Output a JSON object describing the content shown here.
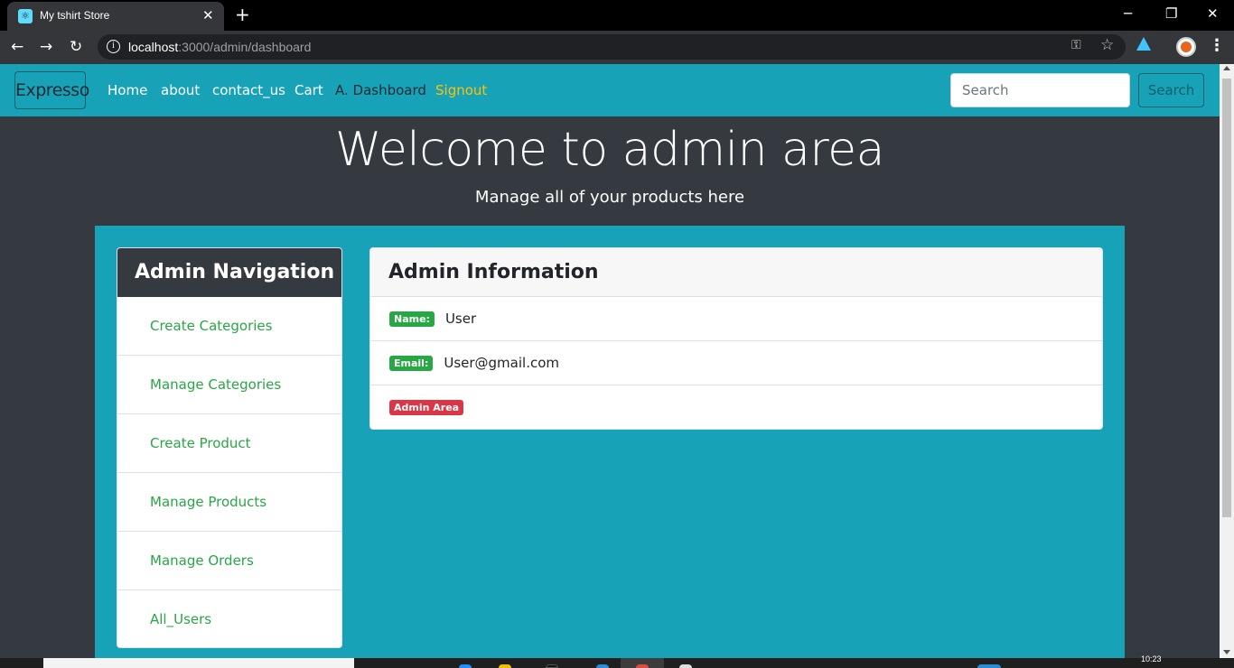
{
  "browser": {
    "tab_title": "My tshirt Store",
    "tab_close": "✕",
    "new_tab": "+",
    "url_host": "localhost",
    "url_path": ":3000/admin/dashboard",
    "window_controls": {
      "minimize": "─",
      "restore": "❐",
      "close": "✕"
    },
    "nav": {
      "back": "←",
      "forward": "→",
      "reload": "↻"
    },
    "icons": [
      "info-icon",
      "key-icon",
      "star-icon",
      "extension-icon",
      "profile-avatar",
      "menu-icon"
    ]
  },
  "navbar": {
    "brand": "Expresso",
    "links": {
      "home": "Home",
      "about": "about",
      "contact": "contact_us",
      "cart": "Cart",
      "dashboard": "A. Dashboard",
      "signout": "Signout"
    },
    "search_placeholder": "Search",
    "search_button": "Search",
    "colors": {
      "bg": "#17a2b8",
      "signout": "#ffc107"
    }
  },
  "header": {
    "title": "Welcome to admin area",
    "subtitle": "Manage all of your products here"
  },
  "admin_nav": {
    "heading": "Admin Navigation",
    "items": [
      {
        "label": "Create Categories"
      },
      {
        "label": "Manage Categories"
      },
      {
        "label": "Create Product"
      },
      {
        "label": "Manage Products"
      },
      {
        "label": "Manage Orders"
      },
      {
        "label": "All_Users"
      }
    ]
  },
  "admin_info": {
    "heading": "Admin Information",
    "name_badge": "Name:",
    "name_value": "User",
    "email_badge": "Email:",
    "email_value": "User@gmail.com",
    "area_badge": "Admin Area"
  },
  "taskbar": {
    "time": "10:23"
  }
}
